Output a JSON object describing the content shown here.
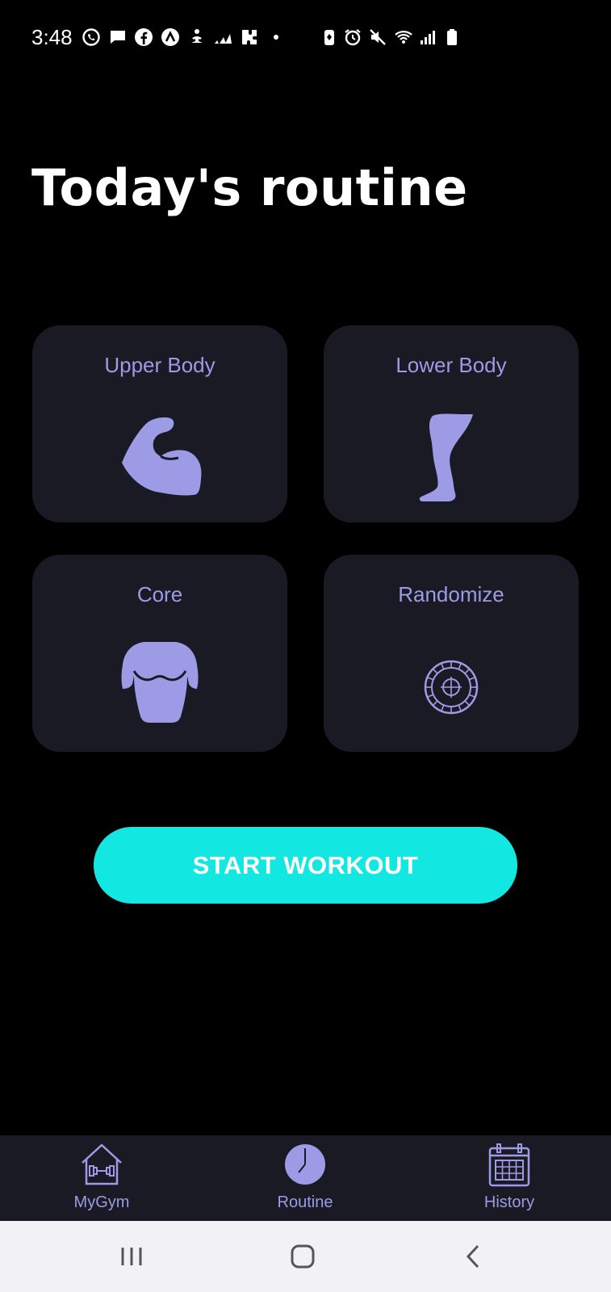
{
  "status_bar": {
    "time": "3:48",
    "left_icons": [
      "whatsapp-icon",
      "message-icon",
      "facebook-icon",
      "app-a-icon",
      "meditation-icon",
      "adidas-icon",
      "puzzle-icon",
      "dot-icon"
    ],
    "right_icons": [
      "battery-saver-icon",
      "alarm-icon",
      "mute-icon",
      "wifi-icon",
      "signal-icon",
      "battery-icon"
    ]
  },
  "page": {
    "title": "Today's routine"
  },
  "cards": [
    {
      "label": "Upper Body",
      "icon": "flexed-bicep-icon"
    },
    {
      "label": "Lower Body",
      "icon": "leg-icon"
    },
    {
      "label": "Core",
      "icon": "torso-icon"
    },
    {
      "label": "Randomize",
      "icon": "roulette-wheel-icon"
    }
  ],
  "start_button": {
    "label": "START WORKOUT"
  },
  "bottom_nav": {
    "items": [
      {
        "label": "MyGym",
        "icon": "gym-house-icon"
      },
      {
        "label": "Routine",
        "icon": "clock-icon",
        "active": true
      },
      {
        "label": "History",
        "icon": "calendar-icon"
      }
    ]
  },
  "system_nav": {
    "buttons": [
      "recent-apps-icon",
      "home-icon",
      "back-icon"
    ]
  },
  "colors": {
    "background": "#000000",
    "card_background": "#1a1a24",
    "accent_purple": "#9d9be5",
    "button_cyan": "#12e7e2",
    "system_nav_background": "#f2f2f4"
  }
}
